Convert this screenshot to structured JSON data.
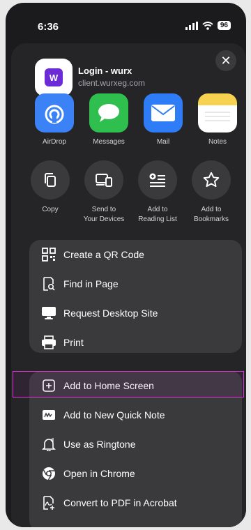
{
  "status": {
    "time": "6:36",
    "battery": "96"
  },
  "site": {
    "title": "Login - wurx",
    "url": "client.wurxeg.com",
    "logo_letter": "W"
  },
  "apps": [
    {
      "label": "AirDrop",
      "icon": "airdrop-icon",
      "color": "#3b82f6"
    },
    {
      "label": "Messages",
      "icon": "messages-icon",
      "color": "#2fbf4f"
    },
    {
      "label": "Mail",
      "icon": "mail-icon",
      "color": "#2e7cf6"
    },
    {
      "label": "Notes",
      "icon": "notes-icon",
      "color": "#f6d250"
    }
  ],
  "actions": [
    {
      "label": "Copy",
      "icon": "copy-icon"
    },
    {
      "label": "Send to\nYour Devices",
      "icon": "devices-icon"
    },
    {
      "label": "Add to\nReading List",
      "icon": "reading-list-icon"
    },
    {
      "label": "Add to\nBookmarks",
      "icon": "star-icon"
    }
  ],
  "menu1": [
    {
      "label": "Create a QR Code",
      "icon": "qr-code-icon"
    },
    {
      "label": "Find in Page",
      "icon": "find-in-page-icon"
    },
    {
      "label": "Request Desktop Site",
      "icon": "desktop-icon"
    },
    {
      "label": "Print",
      "icon": "printer-icon"
    }
  ],
  "menu2": [
    {
      "label": "Add to Home Screen",
      "icon": "add-square-icon"
    },
    {
      "label": "Add to New Quick Note",
      "icon": "quick-note-icon"
    },
    {
      "label": "Use as Ringtone",
      "icon": "bell-icon"
    },
    {
      "label": "Open in Chrome",
      "icon": "chrome-icon"
    },
    {
      "label": "Convert to PDF in Acrobat",
      "icon": "acrobat-icon"
    }
  ]
}
